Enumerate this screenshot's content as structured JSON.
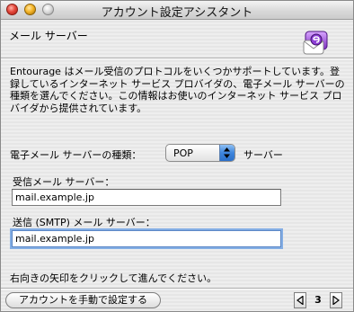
{
  "window": {
    "title": "アカウント設定アシスタント"
  },
  "header": {
    "section_title": "メール サーバー",
    "app_icon": "entourage-icon"
  },
  "intro_text": "Entourage はメール受信のプロトコルをいくつかサポートしています。登録しているインターネット サービス プロバイダの、電子メール サーバーの種類を選んでください。この情報はお使いのインターネット サービス プロバイダから提供されています。",
  "server_type": {
    "label": "電子メール サーバーの種類：",
    "selected": "POP",
    "suffix": "サーバー"
  },
  "incoming": {
    "label": "受信メール サーバー：",
    "value": "mail.example.jp"
  },
  "outgoing": {
    "label": "送信 (SMTP) メール サーバー：",
    "value": "mail.example.jp"
  },
  "hint": "右向きの矢印をクリックして進んでください。",
  "footer": {
    "manual_button": "アカウントを手動で設定する",
    "page": "3"
  },
  "colors": {
    "focus_ring": "#84aee4",
    "popup_accent": "#3e85dc"
  }
}
